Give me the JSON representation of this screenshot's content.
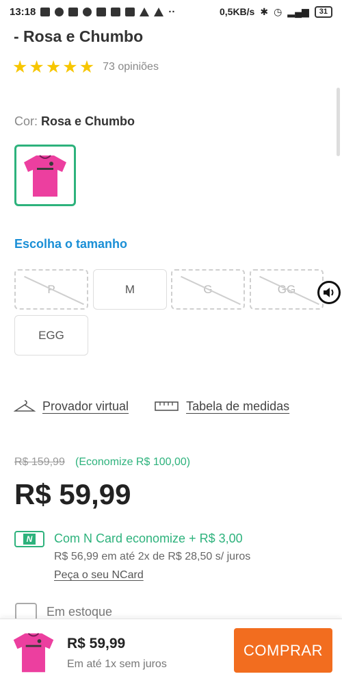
{
  "status_bar": {
    "time": "13:18",
    "network_speed": "0,5KB/s",
    "battery": "31",
    "icons": [
      "tiktok-icon",
      "shield-icon",
      "facebook-icon",
      "mic-off-icon",
      "youtube-icon",
      "youtube-icon",
      "youtube-icon",
      "volume-icon",
      "bell-off-icon",
      "more-icon",
      "bluetooth-icon",
      "alarm-icon",
      "signal-icon"
    ]
  },
  "product": {
    "title_tail": "- Rosa e Chumbo",
    "rating_stars": 5,
    "reviews": "73 opiniões",
    "color_label": "Cor:",
    "color_value": "Rosa e Chumbo"
  },
  "sizes": {
    "heading": "Escolha o tamanho",
    "options": [
      {
        "label": "P",
        "available": false
      },
      {
        "label": "M",
        "available": true
      },
      {
        "label": "G",
        "available": false
      },
      {
        "label": "GG",
        "available": false
      },
      {
        "label": "EGG",
        "available": true
      }
    ]
  },
  "links": {
    "virtual_fitting": "Provador virtual",
    "size_chart": "Tabela de medidas"
  },
  "pricing": {
    "old_price": "R$ 159,99",
    "savings": "(Economize R$ 100,00)",
    "price": "R$ 59,99",
    "ncard_logo": "N",
    "ncard_offer": "Com N Card economize + R$ 3,00",
    "ncard_installments": "R$ 56,99 em até 2x de R$ 28,50 s/ juros",
    "ncard_link": "Peça o seu NCard"
  },
  "stock": {
    "label": "Em estoque"
  },
  "bottom_bar": {
    "price": "R$ 59,99",
    "installments": "Em até 1x sem juros",
    "buy_label": "COMPRAR"
  },
  "colors": {
    "accent_green": "#2db27c",
    "accent_blue": "#1a8fd6",
    "buy_orange": "#f26d1f",
    "star_yellow": "#f7c600",
    "shirt_pink": "#ec3f9f"
  }
}
